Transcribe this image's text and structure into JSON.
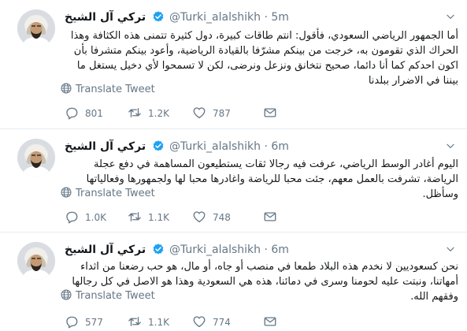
{
  "translate_label": "Translate Tweet",
  "colors": {
    "text": "#14171a",
    "muted": "#657786",
    "verified": "#1da1f2",
    "divider": "#e6ecf0"
  },
  "icons": {
    "reply": "reply-icon",
    "retweet": "retweet-icon",
    "like": "heart-icon",
    "dm": "envelope-icon",
    "translate": "globe-icon",
    "verified": "verified-badge-icon",
    "menu": "chevron-down-icon"
  },
  "tweets": [
    {
      "name": "تركي آل الشيخ",
      "handle": "@Turki_alalshikh",
      "separator": "·",
      "time": "5m",
      "text": "أما الجمهور الرياضي السعودي، فأقول: انتم طاقات كبيرة، دول كثيرة تتمنى هذه الكثافة وهذا الحراك الذي تقومون به، خرجت من بينكم مشرّفا بالقيادة الرياضية، وأعود بينكم متشرفا بأن اكون احدكم كما أنا دائما، صحيح نتخانق ونزعل ونرضى، لكن لا تسمحوا لأي دخيل يستغل ما بيننا في الاضرار ببلدنا",
      "replies": "801",
      "retweets": "1.2K",
      "likes": "787"
    },
    {
      "name": "تركي آل الشيخ",
      "handle": "@Turki_alalshikh",
      "separator": "·",
      "time": "6m",
      "text": "اليوم أغادر الوسط الرياضي، عرفت فيه رجالا ثقات يستطيعون المساهمة في دفع عجلة الرياضة، تشرفت بالعمل معهم، جئت محبا للرياضة واغادرها محبا لها ولجمهورها وفعالياتها وسأظل.",
      "replies": "1.0K",
      "retweets": "1.1K",
      "likes": "748"
    },
    {
      "name": "تركي آل الشيخ",
      "handle": "@Turki_alalshikh",
      "separator": "·",
      "time": "6m",
      "text": "نحن كسعوديين لا نخدم هذه البلاد طمعا في منصب أو جاه، أو مال، هو حب رضعنا من اثداء أمهاتنا، ونبتت عليه لحومنا وسرى في دمائنا، هذه هي السعودية وهذا هو الاصل في كل رجالها وفقهم الله.",
      "replies": "577",
      "retweets": "1.1K",
      "likes": "774"
    }
  ]
}
